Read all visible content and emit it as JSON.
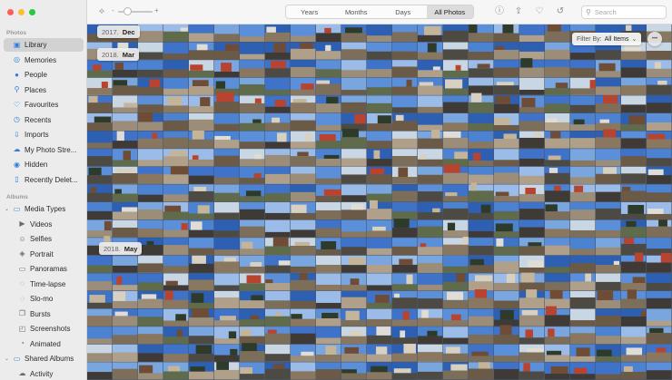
{
  "sidebar": {
    "photos_label": "Photos",
    "albums_label": "Albums",
    "items": [
      {
        "label": "Library",
        "icon": "library-icon",
        "glyph": "▣"
      },
      {
        "label": "Memories",
        "icon": "memories-icon",
        "glyph": "◎"
      },
      {
        "label": "People",
        "icon": "people-icon",
        "glyph": "●"
      },
      {
        "label": "Places",
        "icon": "places-icon",
        "glyph": "⚲"
      },
      {
        "label": "Favourites",
        "icon": "heart-icon",
        "glyph": "♡"
      },
      {
        "label": "Recents",
        "icon": "clock-icon",
        "glyph": "◷"
      },
      {
        "label": "Imports",
        "icon": "import-icon",
        "glyph": "⇩"
      },
      {
        "label": "My Photo Stre...",
        "icon": "cloud-icon",
        "glyph": "☁"
      },
      {
        "label": "Hidden",
        "icon": "eye-icon",
        "glyph": "◉"
      },
      {
        "label": "Recently Delet...",
        "icon": "trash-icon",
        "glyph": "▯"
      }
    ],
    "albums": [
      {
        "label": "Media Types",
        "icon": "folder-icon",
        "glyph": "▭",
        "sub": false
      },
      {
        "label": "Videos",
        "icon": "video-icon",
        "glyph": "▶",
        "sub": true
      },
      {
        "label": "Selfies",
        "icon": "selfie-icon",
        "glyph": "☺",
        "sub": true
      },
      {
        "label": "Portrait",
        "icon": "cube-icon",
        "glyph": "◈",
        "sub": true
      },
      {
        "label": "Panoramas",
        "icon": "panorama-icon",
        "glyph": "▭",
        "sub": true
      },
      {
        "label": "Time-lapse",
        "icon": "timelapse-icon",
        "glyph": "◌",
        "sub": true
      },
      {
        "label": "Slo-mo",
        "icon": "slomo-icon",
        "glyph": "◌",
        "sub": true
      },
      {
        "label": "Bursts",
        "icon": "bursts-icon",
        "glyph": "❐",
        "sub": true
      },
      {
        "label": "Screenshots",
        "icon": "screenshot-icon",
        "glyph": "◰",
        "sub": true
      },
      {
        "label": "Animated",
        "icon": "animated-icon",
        "glyph": "◔",
        "sub": true
      },
      {
        "label": "Shared Albums",
        "icon": "shared-albums-icon",
        "glyph": "▭",
        "sub": false
      },
      {
        "label": "Activity",
        "icon": "activity-icon",
        "glyph": "☁",
        "sub": true
      }
    ]
  },
  "toolbar": {
    "tabs": [
      "Years",
      "Months",
      "Days",
      "All Photos"
    ],
    "active_tab": "All Photos",
    "search_placeholder": "Search",
    "zoom_minus": "-",
    "zoom_plus": "+"
  },
  "grid": {
    "date_headers": [
      {
        "year": "2017.",
        "month": "Dec"
      },
      {
        "year": "2018.",
        "month": "Mar"
      },
      {
        "year": "2018.",
        "month": "May"
      }
    ],
    "filter_prefix": "Filter By:",
    "filter_value": "All Items",
    "more_glyph": "•••"
  },
  "colors": {
    "traffic_close": "#fe5f57",
    "traffic_min": "#febc2e",
    "traffic_max": "#28c840",
    "accent": "#2f7de1",
    "selected": "#d2d2d2"
  }
}
